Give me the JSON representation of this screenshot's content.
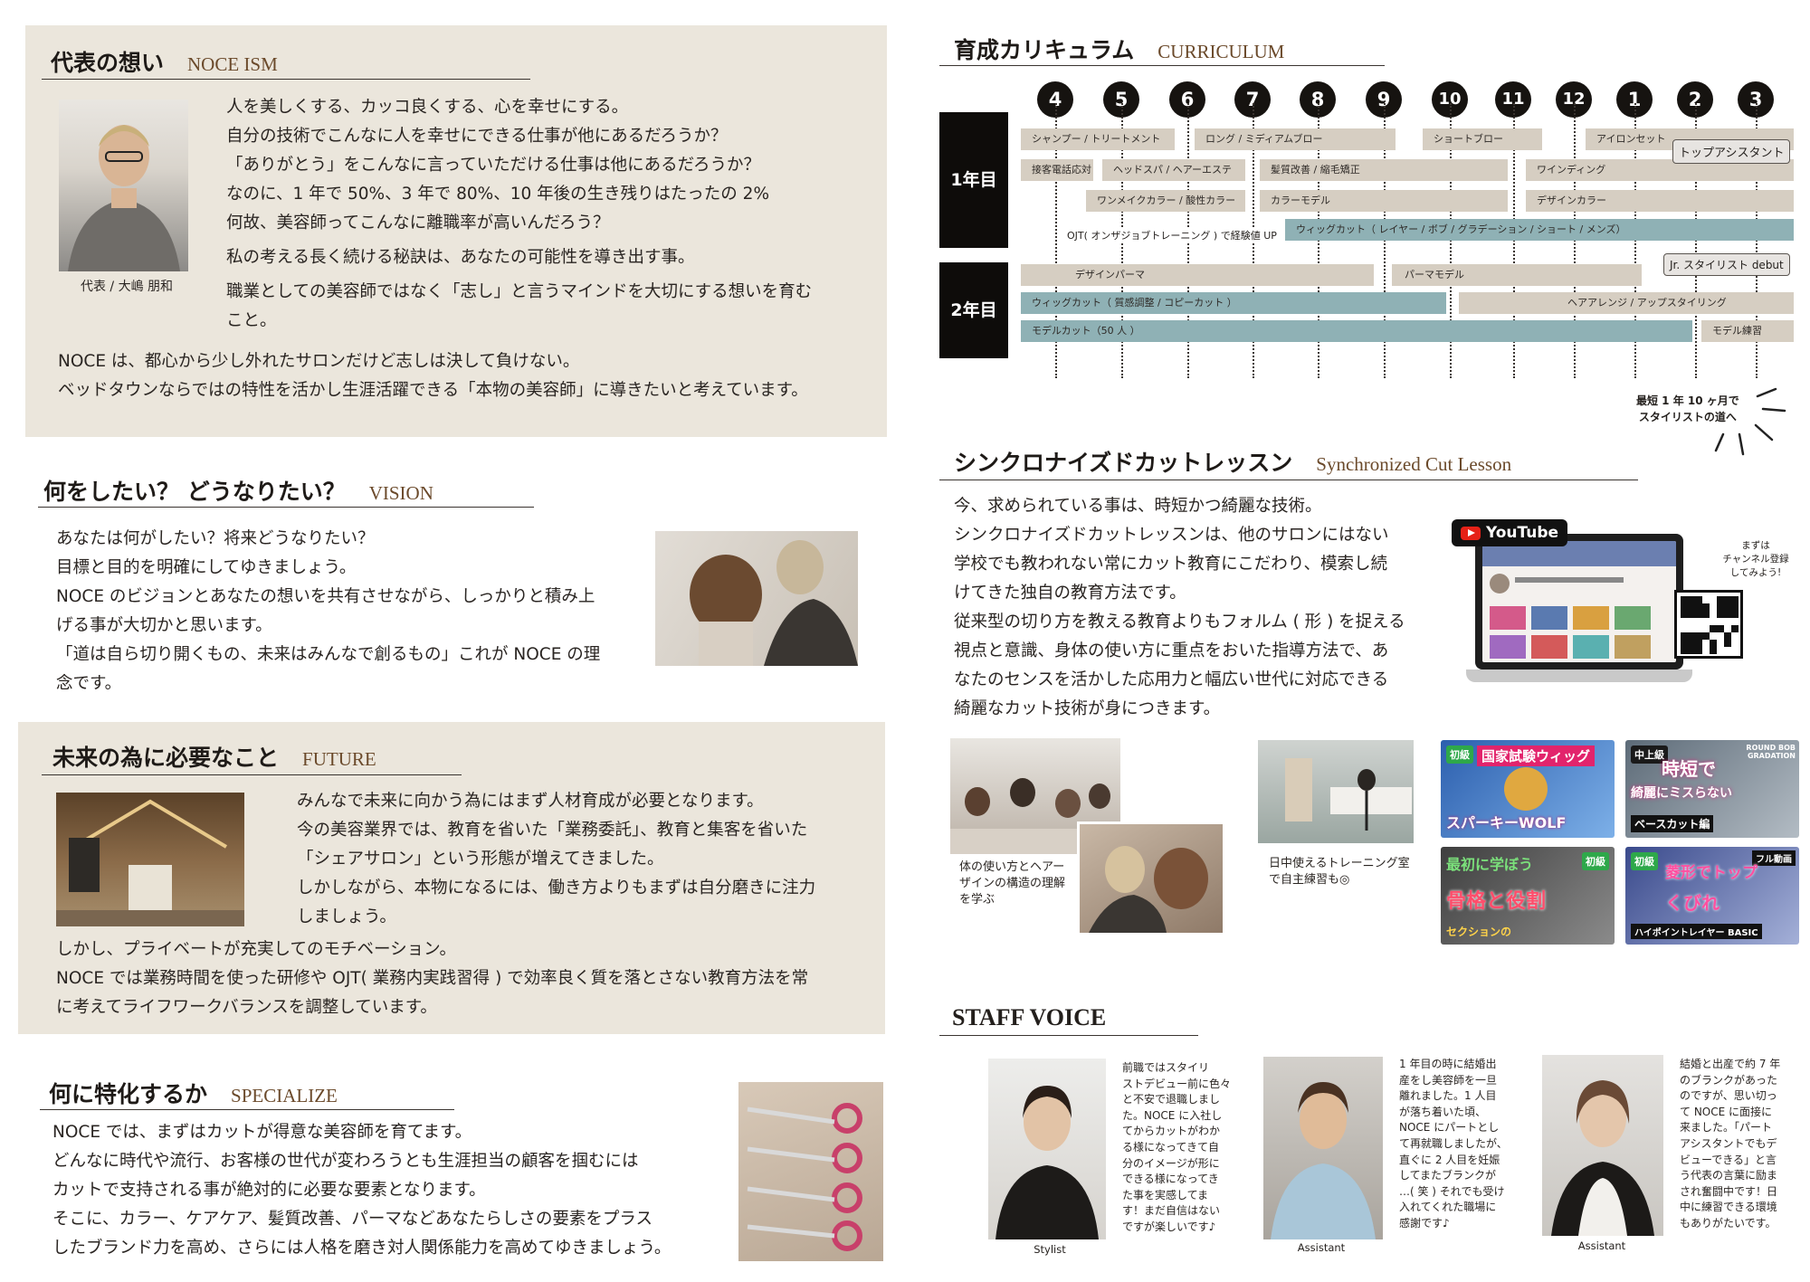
{
  "ism": {
    "title_jp": "代表の想い",
    "title_en": "NOCE ISM",
    "caption": "代表 / 大嶋 朋和",
    "lines": [
      "人を美しくする、カッコ良くする、心を幸せにする。",
      "自分の技術でこんなに人を幸せにできる仕事が他にあるだろうか？",
      "「ありがとう」をこんなに言っていただける仕事は他にあるだろうか？",
      "なのに、1 年で 50%、3 年で 80%、10 年後の生き残りはたったの 2%",
      "何故、美容師ってこんなに離職率が高いんだろう？",
      "私の考える長く続ける秘訣は、あなたの可能性を導き出す事。",
      "職業としての美容師ではなく「志し」と言うマインドを大切にする想いを育む",
      "こと。",
      "NOCE は、都心から少し外れたサロンだけど志しは決して負けない。",
      "ベッドタウンならではの特性を活かし生涯活躍できる「本物の美容師」に導きたいと考えています。"
    ]
  },
  "vision": {
    "title_jp": "何をしたい？ どうなりたい？",
    "title_en": "VISION",
    "lines": [
      "あなたは何がしたい？将来どうなりたい？",
      "目標と目的を明確にしてゆきましょう。",
      "NOCE のビジョンとあなたの想いを共有させながら、しっかりと積み上",
      "げる事が大切かと思います。",
      "「道は自ら切り開くもの、未来はみんなで創るもの」これが NOCE の理",
      "念です。"
    ]
  },
  "future": {
    "title_jp": "未来の為に必要なこと",
    "title_en": "FUTURE",
    "lines": [
      "みんなで未来に向かう為にはまず人材育成が必要となります。",
      "今の美容業界では、教育を省いた「業務委託」、教育と集客を省いた",
      "「シェアサロン」という形態が増えてきました。",
      "しかしながら、本物になるには、働き方よりもまずは自分磨きに注力",
      "しましょう。",
      "しかし、プライベートが充実してのモチベーション。",
      "NOCE では業務時間を使った研修や OJT( 業務内実践習得 ) で効率良く質を落とさない教育方法を常",
      "に考えてライフワークバランスを調整しています。"
    ]
  },
  "specialize": {
    "title_jp": "何に特化するか",
    "title_en": "SPECIALIZE",
    "lines": [
      "NOCE では、まずはカットが得意な美容師を育てます。",
      "どんなに時代や流行、お客様の世代が変わろうとも生涯担当の顧客を掴むには",
      "カットで支持される事が絶対的に必要な要素となります。",
      "そこに、カラー、ケアケア、髪質改善、パーマなどあなたらしさの要素をプラス",
      "したブランド力を高め、さらには人格を磨き対人関係能力を高めてゆきましょう。"
    ]
  },
  "curriculum": {
    "title_jp": "育成カリキュラム",
    "title_en": "CURRICULUM",
    "months": [
      "4",
      "5",
      "6",
      "7",
      "8",
      "9",
      "10",
      "11",
      "12",
      "1",
      "2",
      "3"
    ],
    "year1": "1年目",
    "year2": "2年目",
    "bars": [
      "シャンプー / トリートメント",
      "ロング / ミディアムブロー",
      "ショートブロー",
      "アイロンセット",
      "接客電話応対",
      "ヘッドスパ / ヘアーエステ",
      "髪質改善 / 縮毛矯正",
      "ワインディング",
      "ワンメイクカラー / 酸性カラー",
      "カラーモデル",
      "デザインカラー",
      "ウィッグカット（ レイヤー / ボブ / グラデーション / ショート / メンズ）",
      "デザインパーマ",
      "パーマモデル",
      "ウィッグカット（ 質感調整 / コピーカット ）",
      "ヘアアレンジ / アップスタイリング",
      "モデルカット（50 人 ）",
      "モデル練習"
    ],
    "ojt": "OJT( オンザジョブトレーニング ) で経験値 UP",
    "tag_top": "トップアシスタント",
    "tag_jr": "Jr. スタイリスト debut",
    "shortest_1": "最短 1 年 10 ヶ月で",
    "shortest_2": "スタイリストの道へ"
  },
  "sync": {
    "title_jp": "シンクロナイズドカットレッスン",
    "title_en": "Synchronized Cut Lesson",
    "lines": [
      "今、求められている事は、時短かつ綺麗な技術。",
      "シンクロナイズドカットレッスンは、他のサロンにはない",
      "学校でも教われない常にカット教育にこだわり、模索し続",
      "けてきた独自の教育方法です。",
      "従来型の切り方を教える教育よりもフォルム ( 形 ) を捉える",
      "視点と意識、身体の使い方に重点をおいた指導方法で、あ",
      "なたのセンスを活かした応用力と幅広い世代に対応できる",
      "綺麗なカット技術が身につきます。"
    ],
    "youtube": "YouTube",
    "channel_note": [
      "まずは",
      "チャンネル登録",
      "してみよう!"
    ],
    "cap1": [
      "体の使い方とヘアー",
      "ザインの構造の理解",
      "を学ぶ"
    ],
    "cap2": [
      "日中使えるトレーニング室",
      "で自主練習も◎"
    ],
    "thumbs": [
      {
        "badge": "初級",
        "top": "国家試験ウィッグ",
        "bottom": "スパーキーWOLF"
      },
      {
        "badge": "中上級",
        "top": "時短で",
        "mid": "綺麗にミスらない",
        "bottom": "ベースカット編",
        "corner": "ROUND BOB GRADATION"
      },
      {
        "badge": "初級",
        "top": "最初に学ぼう",
        "mid": "骨格と役割",
        "bottom": "セクションの"
      },
      {
        "badge": "初級",
        "top": "菱形でトップ",
        "mid": "くびれ",
        "bottom": "ハイポイントレイヤー BASIC",
        "corner": "フル動画"
      }
    ]
  },
  "staff": {
    "title": "STAFF VOICE",
    "members": [
      {
        "role": "Stylist",
        "text": [
          "前職ではスタイリ",
          "ストデビュー前に色々",
          "と不安で退職しまし",
          "た。NOCE に入社し",
          "てからカットがわか",
          "る様になってきて自",
          "分のイメージが形に",
          "できる様になってき",
          "た事を実感してま",
          "す！まだ自信はない",
          "ですが楽しいです♪"
        ]
      },
      {
        "role": "Assistant",
        "text": [
          "1 年目の時に結婚出",
          "産をし美容師を一旦",
          "離れました。1 人目",
          "が落ち着いた頃、",
          "NOCE にパートとし",
          "て再就職しましたが、",
          "直ぐに 2 人目を妊娠",
          "してまたブランクが",
          "…( 笑 ) それでも受け",
          "入れてくれた職場に",
          "感謝です♪"
        ]
      },
      {
        "role": "Assistant",
        "text": [
          "結婚と出産で約 7 年",
          "のブランクがあった",
          "のですが、思い切っ",
          "て NOCE に面接に",
          "来ました。「パート",
          "アシスタントでもデ",
          "ビューできる」と言",
          "う代表の言葉に励ま",
          "され奮闘中です！日",
          "中に練習できる環境",
          "もありがたいです。"
        ]
      }
    ]
  }
}
